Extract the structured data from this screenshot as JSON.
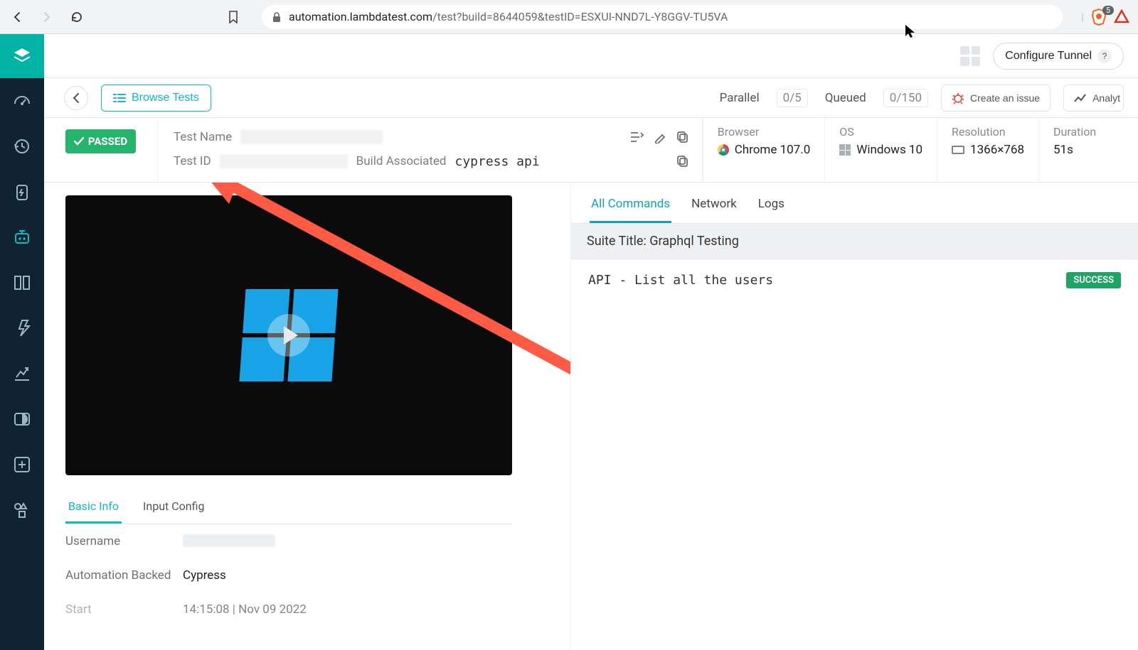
{
  "browser": {
    "url_domain": "automation.lambdatest.com",
    "url_path": "/test?build=8644059&testID=ESXUI-NND7L-Y8GGV-TU5VA",
    "shield_count": "5"
  },
  "top_strip": {
    "configure_tunnel": "Configure Tunnel"
  },
  "sub_header": {
    "browse_tests": "Browse Tests",
    "parallel_label": "Parallel",
    "parallel_value": "0/5",
    "queued_label": "Queued",
    "queued_value": "0/150",
    "create_issue": "Create an issue",
    "analytics": "Analyt"
  },
  "status": {
    "label": "PASSED"
  },
  "names": {
    "test_name_label": "Test Name",
    "test_id_label": "Test ID",
    "build_assoc_label": "Build Associated",
    "build_assoc_value": "cypress api"
  },
  "meta": {
    "browser_label": "Browser",
    "browser_value": "Chrome 107.0",
    "os_label": "OS",
    "os_value": "Windows 10",
    "resolution_label": "Resolution",
    "resolution_value": "1366×768",
    "duration_label": "Duration",
    "duration_value": "51s"
  },
  "info_tabs": {
    "basic": "Basic Info",
    "input": "Input Config"
  },
  "kv": {
    "username_label": "Username",
    "backed_label": "Automation Backed",
    "backed_value": "Cypress",
    "start_label": "Start",
    "start_value": "14:15:08 | Nov 09 2022"
  },
  "cmd_tabs": {
    "all": "All Commands",
    "network": "Network",
    "logs": "Logs"
  },
  "suite": {
    "title": "Suite Title: Graphql Testing"
  },
  "commands": [
    {
      "name": "API - List all the users",
      "status": "SUCCESS"
    }
  ]
}
